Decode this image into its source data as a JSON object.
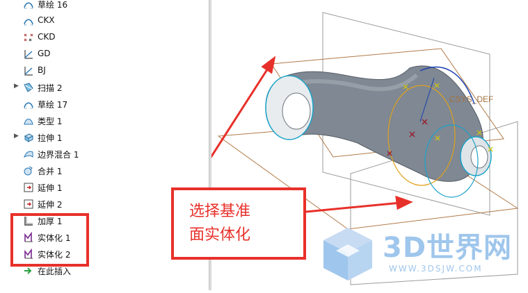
{
  "tree": {
    "items": [
      {
        "label": "草绘 16",
        "icon": "sketch-icon",
        "expandable": false
      },
      {
        "label": "CKX",
        "icon": "sketch-icon",
        "expandable": false
      },
      {
        "label": "CKD",
        "icon": "datum-point-icon",
        "expandable": false
      },
      {
        "label": "GD",
        "icon": "datum-curve-icon",
        "expandable": false
      },
      {
        "label": "BJ",
        "icon": "datum-curve-icon",
        "expandable": false
      },
      {
        "label": "扫描 2",
        "icon": "sweep-icon",
        "expandable": true
      },
      {
        "label": "草绘 17",
        "icon": "sketch-icon",
        "expandable": false
      },
      {
        "label": "类型 1",
        "icon": "style-surface-icon",
        "expandable": false
      },
      {
        "label": "拉伸 1",
        "icon": "extrude-icon",
        "expandable": true
      },
      {
        "label": "边界混合 1",
        "icon": "boundary-blend-icon",
        "expandable": false
      },
      {
        "label": "合并 1",
        "icon": "merge-icon",
        "expandable": false
      },
      {
        "label": "延伸 1",
        "icon": "extend-icon",
        "expandable": false
      },
      {
        "label": "延伸 2",
        "icon": "extend-icon",
        "expandable": false
      },
      {
        "label": "加厚 1",
        "icon": "thicken-icon",
        "expandable": false
      },
      {
        "label": "实体化 1",
        "icon": "solidify-icon",
        "expandable": false
      },
      {
        "label": "实体化 2",
        "icon": "solidify-icon",
        "expandable": false
      },
      {
        "label": "在此插入",
        "icon": "insert-here-icon",
        "expandable": false
      }
    ]
  },
  "viewport": {
    "csys_label": "PRT_CSYS_DEF",
    "csys_partial_label": "CSYS_DEF"
  },
  "callout": {
    "text": "选择基准\n面实体化"
  },
  "watermark": {
    "brand": "3D世界网",
    "url": "WWW.3DSJW.COM"
  },
  "colors": {
    "annotation": "#e8302a",
    "model_gray": "#7e8792",
    "curve_cyan": "#1aa3c9",
    "datum_brown": "#b07a48",
    "curve_orange": "#e0a21c",
    "watermark_blue": "#9fc6ec"
  }
}
